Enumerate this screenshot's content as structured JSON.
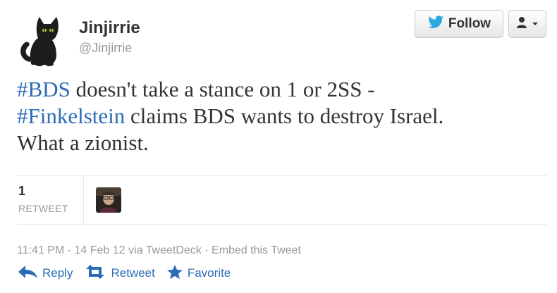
{
  "user": {
    "name": "Jinjirrie",
    "handle": "@Jinjirrie"
  },
  "follow_button": {
    "label": "Follow",
    "icon": "twitter-bird-icon"
  },
  "user_menu": {
    "icon": "user-icon"
  },
  "tweet": {
    "line1_hashtag": "#BDS",
    "line1_text": " doesn't take a stance on 1 or 2SS -",
    "line2_hashtag": "#Finkelstein",
    "line2_text": " claims BDS wants to destroy Israel.",
    "line3_text": "What a zionist."
  },
  "stats": {
    "retweet_count": "1",
    "retweet_label": "RETWEET"
  },
  "meta": {
    "timestamp": "11:41 PM - 14 Feb 12",
    "via": "via TweetDeck",
    "separator": "·",
    "embed": "Embed this Tweet"
  },
  "actions": [
    {
      "label": "Reply",
      "icon": "reply-icon"
    },
    {
      "label": "Retweet",
      "icon": "retweet-icon"
    },
    {
      "label": "Favorite",
      "icon": "star-icon"
    }
  ],
  "colors": {
    "link": "#2b6cb5",
    "twitter_bird": "#2ea7e0",
    "muted": "#999999",
    "text": "#333333"
  }
}
